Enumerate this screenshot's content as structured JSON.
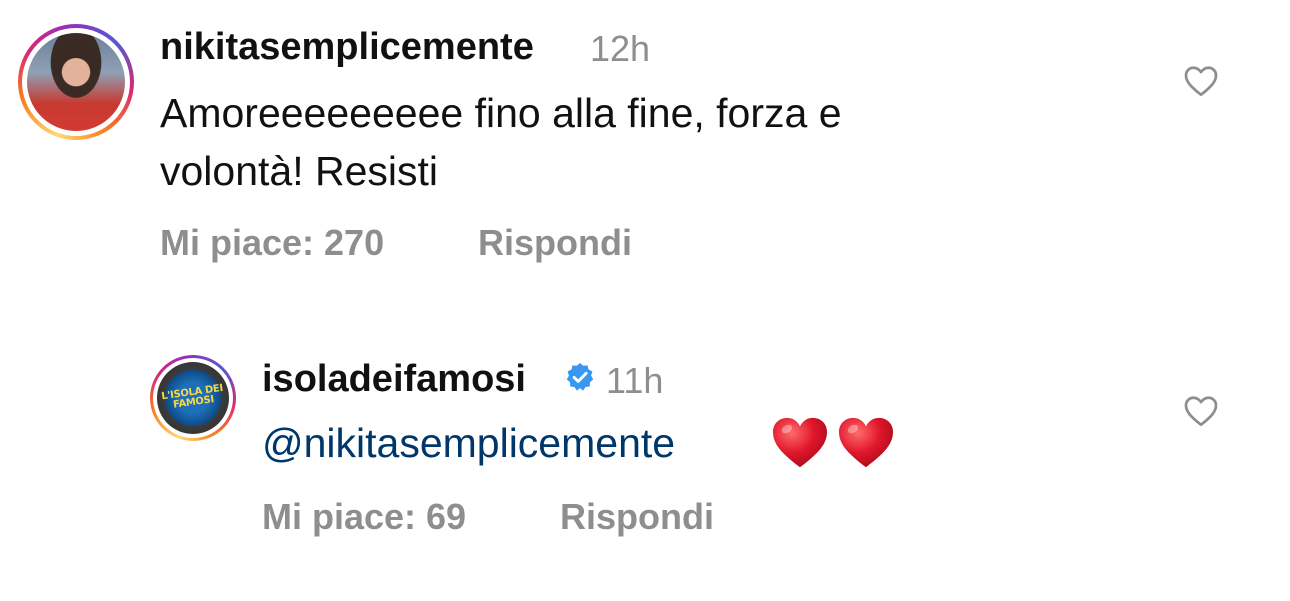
{
  "comments": [
    {
      "username": "nikitasemplicemente",
      "time": "12h",
      "text_line_1": "Amoreeeeeeeee fino alla fine, forza e",
      "text_line_2": "volontà! Resisti",
      "likes_label": "Mi piace: 270",
      "reply_label": "Rispondi",
      "avatar_icon": "profile-photo"
    },
    {
      "username": "isoladeifamosi",
      "verified": true,
      "time": "11h",
      "mention": "@nikitasemplicemente",
      "emojis": [
        "red-heart",
        "red-heart"
      ],
      "likes_label": "Mi piace: 69",
      "reply_label": "Rispondi",
      "avatar_logo_line_1": "L'ISOLA DEI",
      "avatar_logo_line_2": "FAMOSI"
    }
  ],
  "colors": {
    "text": "#111111",
    "secondary": "#8e8e8e",
    "mention": "#00376b",
    "verified": "#3897f0",
    "heart": "#e0162b"
  }
}
